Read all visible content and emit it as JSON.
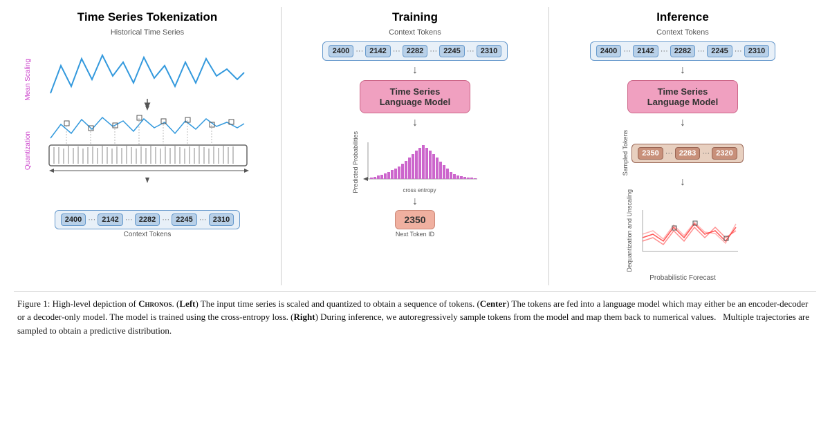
{
  "panels": {
    "left": {
      "title": "Time Series Tokenization",
      "historical_label": "Historical Time Series",
      "mean_scaling_label": "Mean Scaling",
      "quantization_label": "Quantization",
      "context_tokens_label": "Context Tokens",
      "tokens": [
        "2400",
        "...",
        "2142",
        "...",
        "2282",
        "...",
        "2245",
        "...",
        "2310"
      ]
    },
    "center": {
      "title": "Training",
      "context_tokens_label": "Context Tokens",
      "tokens": [
        "2400",
        "...",
        "2142",
        "...",
        "2282",
        "...",
        "2245",
        "...",
        "2310"
      ],
      "model_label_line1": "Time Series",
      "model_label_line2": "Language Model",
      "predicted_probs_label": "Predicted Probabilities",
      "cross_entropy_label": "cross\nentropy",
      "next_token_value": "2350",
      "next_token_label": "Next Token ID"
    },
    "right": {
      "title": "Inference",
      "context_tokens_label": "Context Tokens",
      "tokens": [
        "2400",
        "...",
        "2142",
        "...",
        "2282",
        "...",
        "2245",
        "...",
        "2310"
      ],
      "model_label_line1": "Time Series",
      "model_label_line2": "Language Model",
      "sampled_tokens_label": "Sampled Tokens",
      "sampled_tokens": [
        "2350",
        "...",
        "2283",
        "...",
        "2320"
      ],
      "dequant_label": "Dequantization\nand Unscaling",
      "prob_forecast_label": "Probabilistic Forecast"
    }
  },
  "caption": {
    "figure_num": "Figure 1:",
    "text": "High-level depiction of Chronos. (Left) The input time series is scaled and quantized to obtain a sequence of tokens. (Center) The tokens are fed into a language model which may either be an encoder-decoder or a decoder-only model. The model is trained using the cross-entropy loss. (Right) During inference, we autoregressively sample tokens from the model and map them back to numerical values. Multiple trajectories are sampled to obtain a predictive distribution."
  },
  "bars_data": [
    2,
    3,
    4,
    3,
    5,
    6,
    7,
    9,
    11,
    14,
    18,
    22,
    28,
    35,
    42,
    50,
    42,
    35,
    28,
    20,
    15,
    11,
    8,
    6,
    4,
    3,
    2,
    2,
    1,
    1
  ]
}
